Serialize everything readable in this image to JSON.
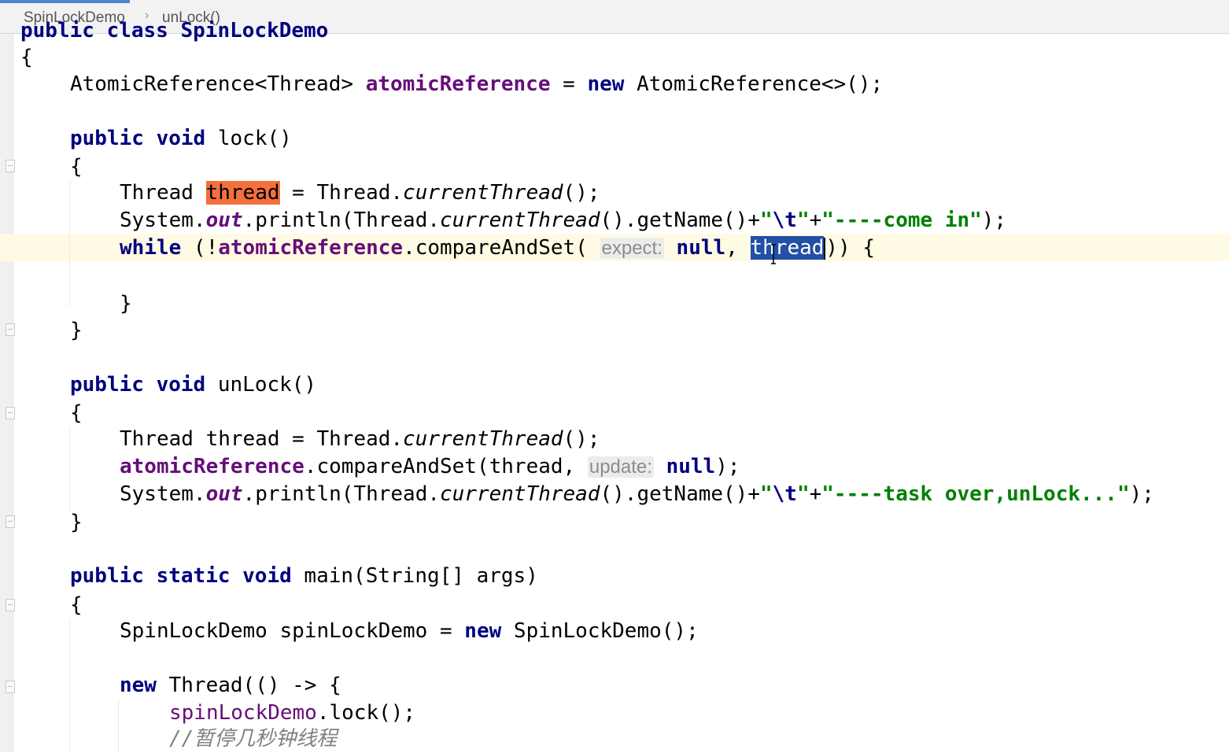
{
  "breadcrumb": {
    "items": [
      "SpinLockDemo",
      "unLock()"
    ],
    "separator": "›"
  },
  "editor": {
    "class_decl_partial": "public class SpinLockDemo",
    "brace_open": "{",
    "line_field": {
      "type": "AtomicReference<Thread> ",
      "name": "atomicReference",
      "eq": " = ",
      "kw_new": "new",
      "init": " AtomicReference<>();"
    },
    "lock_sig": {
      "kw1": "public",
      "kw2": "void",
      "name": " lock()"
    },
    "lock_body": {
      "l1_type": "Thread ",
      "l1_var": "thread",
      "l1_rest1": " = Thread.",
      "l1_method": "currentThread",
      "l1_rest2": "();",
      "l2_a": "System.",
      "l2_out": "out",
      "l2_b": ".println(Thread.",
      "l2_method": "currentThread",
      "l2_c": "().getName()+",
      "l2_q1": "\"",
      "l2_esc": "\\t",
      "l2_q2": "\"",
      "l2_plus": "+",
      "l2_str": "\"----come in\"",
      "l2_end": ");",
      "l3_kw": "while",
      "l3_a": " (!",
      "l3_field": "atomicReference",
      "l3_b": ".compareAndSet( ",
      "l3_hint": "expect:",
      "l3_null": " null",
      "l3_c": ", ",
      "l3_sel": "thread",
      "l3_d": ")) {",
      "close_inner": "}"
    },
    "brace_close": "}",
    "unlock_sig": {
      "kw1": "public",
      "kw2": "void",
      "name": " unLock()"
    },
    "unlock_body": {
      "l1": "Thread thread = Thread.",
      "l1_method": "currentThread",
      "l1_end": "();",
      "l2_field": "atomicReference",
      "l2_a": ".compareAndSet(thread, ",
      "l2_hint": "update:",
      "l2_null": " null",
      "l2_end": ");",
      "l3_a": "System.",
      "l3_out": "out",
      "l3_b": ".println(Thread.",
      "l3_method": "currentThread",
      "l3_c": "().getName()+",
      "l3_q1": "\"",
      "l3_esc": "\\t",
      "l3_q2": "\"",
      "l3_plus": "+",
      "l3_str": "\"----task over,unLock...\"",
      "l3_end": ");"
    },
    "main_sig": {
      "kw1": "public",
      "kw2": "static",
      "kw3": "void",
      "rest": " main(String[] args)"
    },
    "main_body": {
      "l1_a": "SpinLockDemo spinLockDemo = ",
      "l1_kw": "new",
      "l1_b": " SpinLockDemo();",
      "l2_kw": "new",
      "l2_b": " Thread(() -> {",
      "l3_field": "spinLockDemo",
      "l3_b": ".lock();",
      "l4_comment": "//暂停几秒钟线程"
    }
  },
  "colors": {
    "keyword": "#000080",
    "field": "#660e7a",
    "string": "#008000",
    "comment": "#808080",
    "caret_row": "#fffae3",
    "selection": "#2150a6",
    "usage_highlight": "#f36f3c"
  }
}
